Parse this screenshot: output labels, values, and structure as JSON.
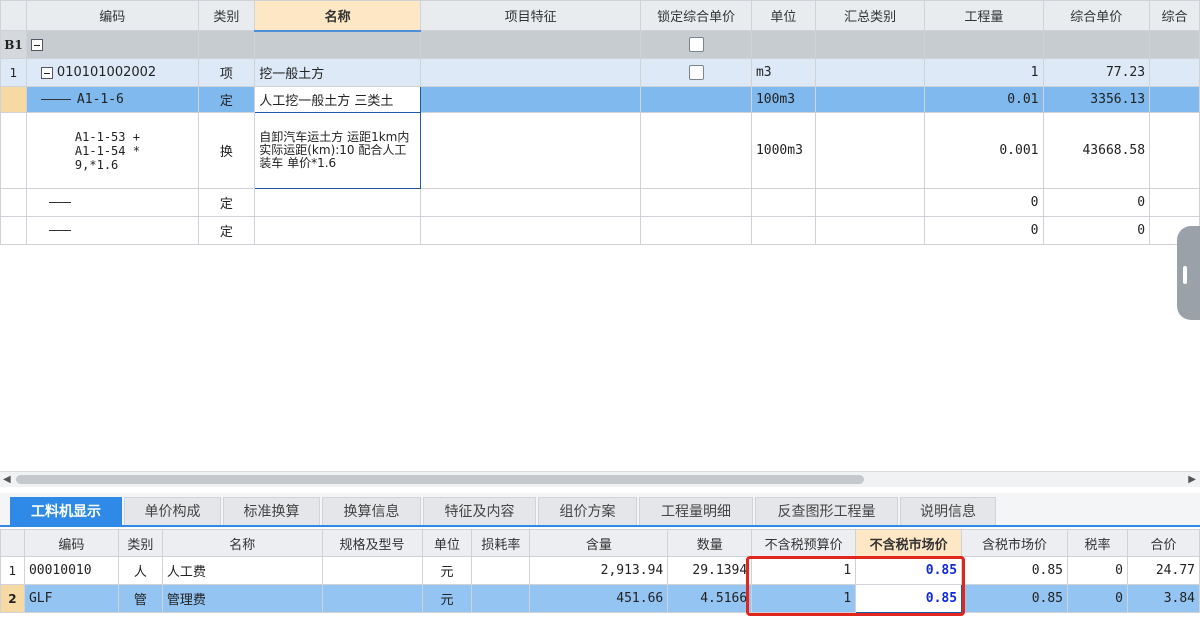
{
  "top_grid": {
    "headers": {
      "code": "编码",
      "type": "类别",
      "name": "名称",
      "feature": "项目特征",
      "lock": "锁定综合单价",
      "unit": "单位",
      "summary": "汇总类别",
      "qty": "工程量",
      "price": "综合单价",
      "total": "综合"
    },
    "group_row": {
      "num": "B1"
    },
    "qd_row": {
      "num": "1",
      "code": "010101002002",
      "type": "项",
      "name": "挖一般土方",
      "unit": "m3",
      "qty": "1",
      "price": "77.23"
    },
    "sel_row": {
      "code": "A1-1-6",
      "type": "定",
      "name": "人工挖一般土方 三类土",
      "unit": "100m3",
      "qty": "0.01",
      "price": "3356.13"
    },
    "huan_row": {
      "code": "A1-1-53 +\nA1-1-54 *\n9,*1.6",
      "type": "换",
      "name": "自卸汽车运土方 运距1km内  实际运距(km):10  配合人工装车 单价*1.6",
      "unit": "1000m3",
      "qty": "0.001",
      "price": "43668.58"
    },
    "empty_rows": [
      {
        "type": "定",
        "qty": "0",
        "price": "0"
      },
      {
        "type": "定",
        "qty": "0",
        "price": "0"
      }
    ]
  },
  "tabs": [
    {
      "label": "工料机显示",
      "active": true
    },
    {
      "label": "单价构成",
      "active": false
    },
    {
      "label": "标准换算",
      "active": false
    },
    {
      "label": "换算信息",
      "active": false
    },
    {
      "label": "特征及内容",
      "active": false
    },
    {
      "label": "组价方案",
      "active": false
    },
    {
      "label": "工程量明细",
      "active": false
    },
    {
      "label": "反查图形工程量",
      "active": false
    },
    {
      "label": "说明信息",
      "active": false
    }
  ],
  "bottom_grid": {
    "headers": {
      "code": "编码",
      "type": "类别",
      "name": "名称",
      "spec": "规格及型号",
      "unit": "单位",
      "loss": "损耗率",
      "content": "含量",
      "amount": "数量",
      "budget": "不含税预算价",
      "market": "不含税市场价",
      "tax_market": "含税市场价",
      "tax_rate": "税率",
      "sum": "合价"
    },
    "rows": [
      {
        "num": "1",
        "code": "00010010",
        "type": "人",
        "name": "人工费",
        "unit": "元",
        "content": "2,913.94",
        "amount": "29.1394",
        "budget": "1",
        "market": "0.85",
        "tax_market": "0.85",
        "tax_rate": "0",
        "sum": "24.77"
      },
      {
        "num": "2",
        "code": "GLF",
        "type": "管",
        "name": "管理费",
        "unit": "元",
        "content": "451.66",
        "amount": "4.5166",
        "budget": "1",
        "market": "0.85",
        "tax_market": "0.85",
        "tax_rate": "0",
        "sum": "3.84"
      }
    ]
  },
  "icons": {
    "collapse": "minus-box-icon",
    "checkbox": "checkbox-icon",
    "scroll_left": "arrow-left-icon",
    "scroll_right": "arrow-right-icon"
  },
  "colors": {
    "accent": "#2e8ae6",
    "selected_row": "#7fb9ee",
    "highlight_box": "#e0261d",
    "market_text": "#1029d8"
  }
}
